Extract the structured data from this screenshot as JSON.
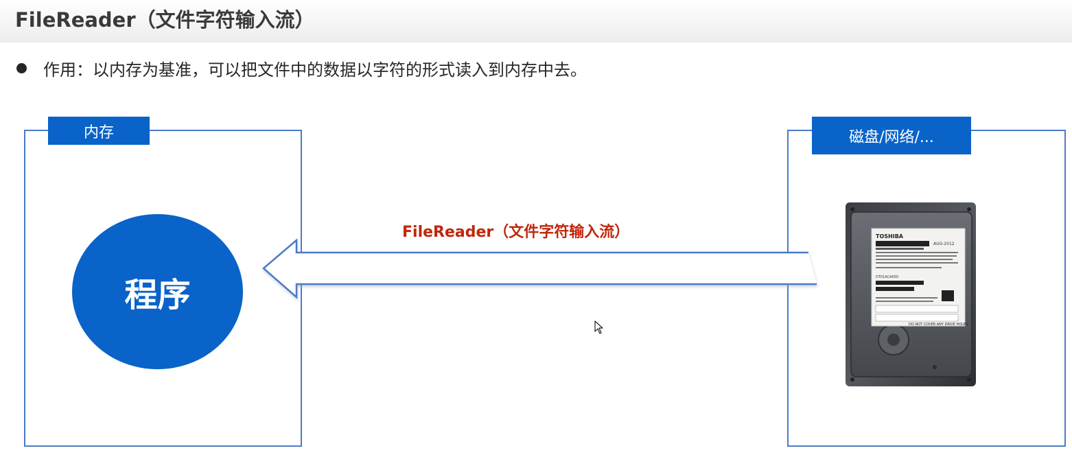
{
  "header": {
    "title": "FileReader（文件字符输入流）"
  },
  "bullet": {
    "text": "作用：以内存为基准，可以把文件中的数据以字符的形式读入到内存中去。"
  },
  "memory_box": {
    "label": "内存",
    "program_label": "程序"
  },
  "source_box": {
    "label": "磁盘/网络/..."
  },
  "arrow": {
    "label": "FileReader（文件字符输入流）",
    "direction": "right-to-left"
  },
  "hard_drive": {
    "brand": "TOSHIBA",
    "date": "AUG-2012",
    "warning": "DO NOT COVER ANY DRIVE HOLES",
    "model": "DT01ACA050",
    "icon": "hard-disk-drive-icon"
  },
  "colors": {
    "accent_blue": "#0a63c8",
    "box_border": "#4a7ac8",
    "arrow_label": "#c0270c",
    "title_text": "#3a3a3a"
  }
}
